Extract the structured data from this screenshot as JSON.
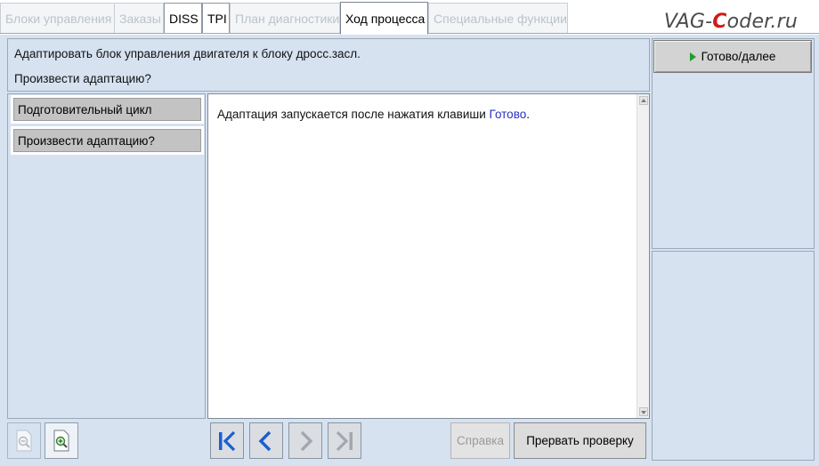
{
  "tabs": [
    {
      "label": "Блоки управления",
      "state": "disabled"
    },
    {
      "label": "Заказы",
      "state": "disabled"
    },
    {
      "label": "DISS",
      "state": "enabled"
    },
    {
      "label": "TPI",
      "state": "enabled"
    },
    {
      "label": "План диагностики",
      "state": "disabled"
    },
    {
      "label": "Ход процесса",
      "state": "active"
    },
    {
      "label": "Специальные функции",
      "state": "disabled"
    }
  ],
  "watermark": {
    "prefix": "VAG-",
    "accent": "C",
    "suffix": "oder.ru"
  },
  "header": {
    "line1": "Адаптировать блок управления двигателя к блоку дросс.засл.",
    "line2": "Произвести адаптацию?"
  },
  "steps": [
    {
      "label": "Подготовительный цикл"
    },
    {
      "label": "Произвести адаптацию?"
    }
  ],
  "content": {
    "text_before": "Адаптация запускается после нажатия клавиши ",
    "link_text": "Готово",
    "text_after": "."
  },
  "actions": {
    "ready_label": "Готово/далее",
    "help_label": "Справка",
    "abort_label": "Прервать проверку"
  },
  "icons": {
    "ready": "play-icon",
    "zoom_out": "zoom-out-icon",
    "zoom_in": "zoom-in-icon",
    "first": "skip-to-start-icon",
    "back": "chevron-left-icon",
    "forward": "chevron-right-icon",
    "last": "skip-to-end-icon"
  },
  "colors": {
    "panel_bg": "#d6e2f0",
    "link": "#2a2fc0",
    "nav_active": "#1a5fd0",
    "play": "#1f9d2a",
    "watermark_accent": "#d11a1a"
  }
}
